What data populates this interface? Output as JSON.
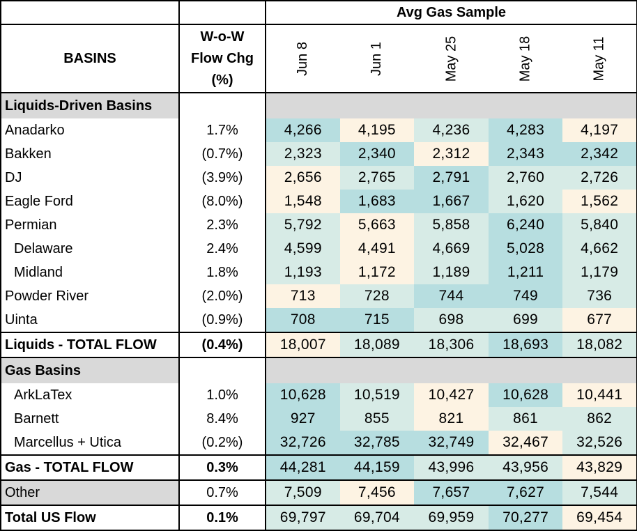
{
  "colors": {
    "teal": "#b7dee0",
    "light_teal": "#d7ebe6",
    "cream": "#fdf3e3",
    "section_gray": "#d9d9d9"
  },
  "header": {
    "group_label": "Avg Gas Sample",
    "basins_label": "BASINS",
    "chg_label_line1": "W-o-W",
    "chg_label_line2": "Flow Chg",
    "chg_label_line3": "(%)",
    "weeks": [
      "Jun 8",
      "Jun 1",
      "May 25",
      "May 18",
      "May 11"
    ]
  },
  "chart_data": {
    "type": "table",
    "columns": [
      "BASINS",
      "W-o-W Flow Chg (%)",
      "Jun 8",
      "Jun 1",
      "May 25",
      "May 18",
      "May 11"
    ],
    "sections": [
      {
        "title": "Liquids-Driven Basins",
        "rows": [
          {
            "name": "Anadarko",
            "chg": "1.7%",
            "values": [
              "4,266",
              "4,195",
              "4,236",
              "4,283",
              "4,197"
            ],
            "shades": [
              "teal",
              "cream",
              "light_teal",
              "teal",
              "cream"
            ]
          },
          {
            "name": "Bakken",
            "chg": "(0.7%)",
            "values": [
              "2,323",
              "2,340",
              "2,312",
              "2,343",
              "2,342"
            ],
            "shades": [
              "light_teal",
              "teal",
              "cream",
              "teal",
              "teal"
            ]
          },
          {
            "name": "DJ",
            "chg": "(3.9%)",
            "values": [
              "2,656",
              "2,765",
              "2,791",
              "2,760",
              "2,726"
            ],
            "shades": [
              "cream",
              "light_teal",
              "teal",
              "light_teal",
              "light_teal"
            ]
          },
          {
            "name": "Eagle Ford",
            "chg": "(8.0%)",
            "values": [
              "1,548",
              "1,683",
              "1,667",
              "1,620",
              "1,562"
            ],
            "shades": [
              "cream",
              "teal",
              "teal",
              "light_teal",
              "cream"
            ]
          },
          {
            "name": "Permian",
            "chg": "2.3%",
            "values": [
              "5,792",
              "5,663",
              "5,858",
              "6,240",
              "5,840"
            ],
            "shades": [
              "light_teal",
              "cream",
              "light_teal",
              "teal",
              "light_teal"
            ]
          },
          {
            "name": "Delaware",
            "chg": "2.4%",
            "indent": true,
            "values": [
              "4,599",
              "4,491",
              "4,669",
              "5,028",
              "4,662"
            ],
            "shades": [
              "light_teal",
              "cream",
              "light_teal",
              "teal",
              "light_teal"
            ]
          },
          {
            "name": "Midland",
            "chg": "1.8%",
            "indent": true,
            "values": [
              "1,193",
              "1,172",
              "1,189",
              "1,211",
              "1,179"
            ],
            "shades": [
              "light_teal",
              "cream",
              "light_teal",
              "teal",
              "light_teal"
            ]
          },
          {
            "name": "Powder River",
            "chg": "(2.0%)",
            "values": [
              "713",
              "728",
              "744",
              "749",
              "736"
            ],
            "shades": [
              "cream",
              "light_teal",
              "teal",
              "teal",
              "light_teal"
            ]
          },
          {
            "name": "Uinta",
            "chg": "(0.9%)",
            "values": [
              "708",
              "715",
              "698",
              "699",
              "677"
            ],
            "shades": [
              "teal",
              "teal",
              "light_teal",
              "light_teal",
              "cream"
            ]
          }
        ],
        "total": {
          "name": "Liquids - TOTAL FLOW",
          "chg": "(0.4%)",
          "values": [
            "18,007",
            "18,089",
            "18,306",
            "18,693",
            "18,082"
          ],
          "shades": [
            "cream",
            "light_teal",
            "light_teal",
            "teal",
            "light_teal"
          ]
        }
      },
      {
        "title": "Gas Basins",
        "rows": [
          {
            "name": "ArkLaTex",
            "chg": "1.0%",
            "indent": true,
            "values": [
              "10,628",
              "10,519",
              "10,427",
              "10,628",
              "10,441"
            ],
            "shades": [
              "teal",
              "light_teal",
              "cream",
              "teal",
              "cream"
            ]
          },
          {
            "name": "Barnett",
            "chg": "8.4%",
            "indent": true,
            "values": [
              "927",
              "855",
              "821",
              "861",
              "862"
            ],
            "shades": [
              "teal",
              "light_teal",
              "cream",
              "light_teal",
              "light_teal"
            ]
          },
          {
            "name": "Marcellus + Utica",
            "chg": "(0.2%)",
            "indent": true,
            "values": [
              "32,726",
              "32,785",
              "32,749",
              "32,467",
              "32,526"
            ],
            "shades": [
              "teal",
              "teal",
              "teal",
              "cream",
              "light_teal"
            ]
          }
        ],
        "total": {
          "name": "Gas - TOTAL FLOW",
          "chg": "0.3%",
          "values": [
            "44,281",
            "44,159",
            "43,996",
            "43,956",
            "43,829"
          ],
          "shades": [
            "teal",
            "teal",
            "light_teal",
            "light_teal",
            "cream"
          ]
        }
      }
    ],
    "other": {
      "name": "Other",
      "chg": "0.7%",
      "values": [
        "7,509",
        "7,456",
        "7,657",
        "7,627",
        "7,544"
      ],
      "shades": [
        "light_teal",
        "cream",
        "teal",
        "teal",
        "light_teal"
      ]
    },
    "grand_total": {
      "name": "Total US Flow",
      "chg": "0.1%",
      "values": [
        "69,797",
        "69,704",
        "69,959",
        "70,277",
        "69,454"
      ],
      "shades": [
        "light_teal",
        "light_teal",
        "light_teal",
        "teal",
        "cream"
      ]
    }
  }
}
